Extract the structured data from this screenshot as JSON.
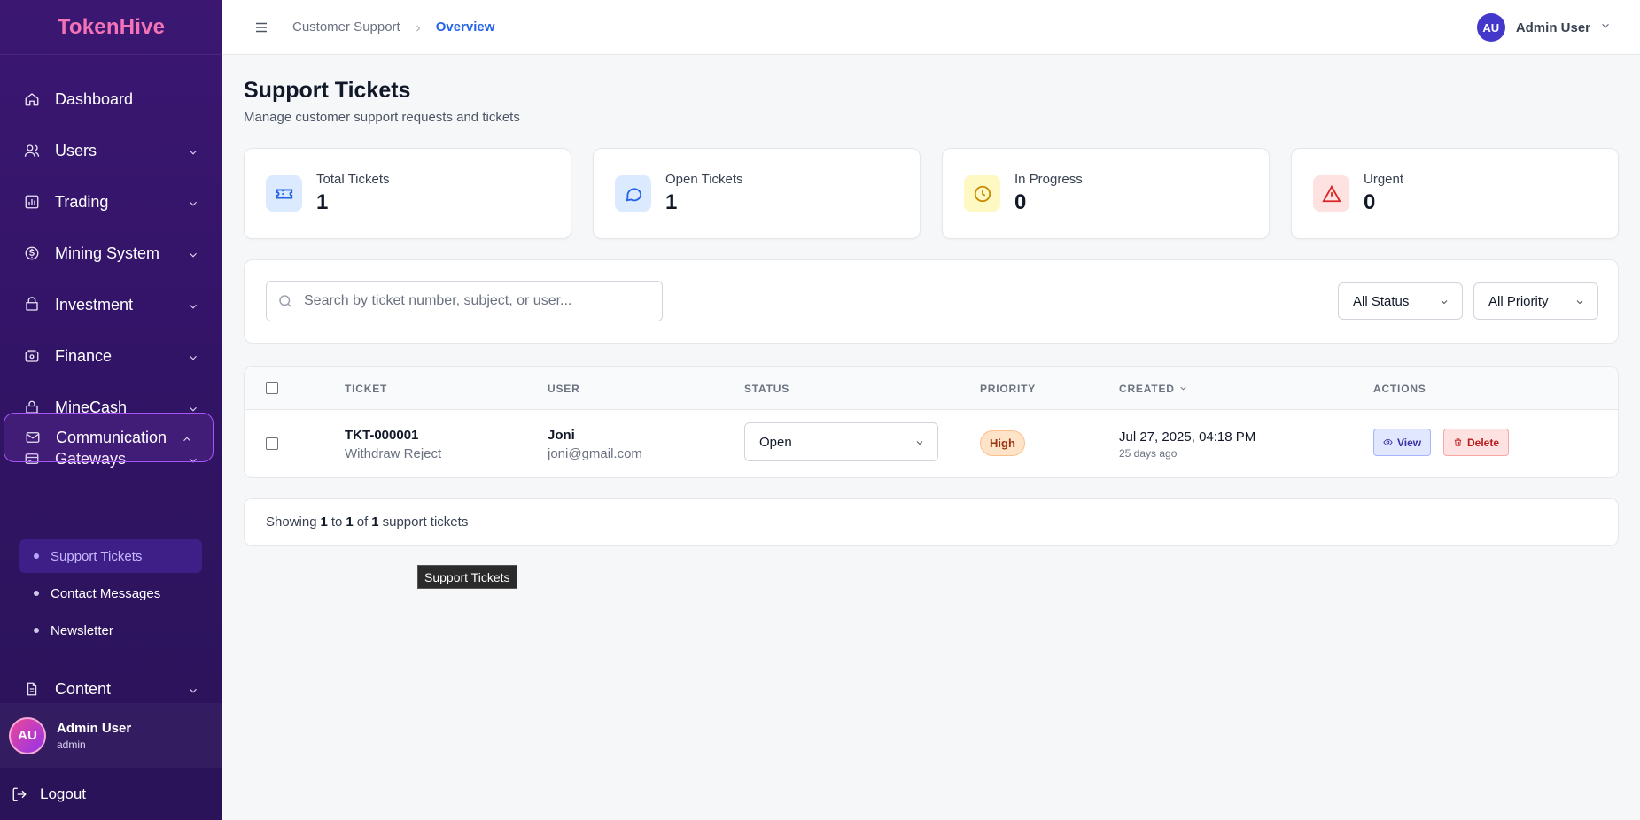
{
  "app": {
    "brand": "TokenHive"
  },
  "sidebar": {
    "items": [
      {
        "label": "Dashboard",
        "icon": "home-icon"
      },
      {
        "label": "Users",
        "icon": "users-icon"
      },
      {
        "label": "Trading",
        "icon": "chart-icon"
      },
      {
        "label": "Mining System",
        "icon": "dollar-circle-icon"
      },
      {
        "label": "Investment",
        "icon": "briefcase-icon"
      },
      {
        "label": "Finance",
        "icon": "wallet-icon"
      },
      {
        "label": "MineCash",
        "icon": "bag-icon"
      },
      {
        "label": "Gateways",
        "icon": "card-icon"
      },
      {
        "label": "Communication",
        "icon": "mail-icon"
      },
      {
        "label": "Content",
        "icon": "document-icon"
      }
    ],
    "submenu": [
      {
        "label": "Support Tickets"
      },
      {
        "label": "Contact Messages"
      },
      {
        "label": "Newsletter"
      }
    ],
    "user": {
      "initials": "AU",
      "name": "Admin User",
      "role": "admin"
    },
    "logout": "Logout"
  },
  "header": {
    "breadcrumb": {
      "parent": "Customer Support",
      "current": "Overview"
    },
    "user": {
      "initials": "AU",
      "name": "Admin User"
    }
  },
  "page": {
    "title": "Support Tickets",
    "subtitle": "Manage customer support requests and tickets"
  },
  "stats": [
    {
      "label": "Total Tickets",
      "value": "1",
      "color": "#2563eb"
    },
    {
      "label": "Open Tickets",
      "value": "1",
      "color": "#2563eb"
    },
    {
      "label": "In Progress",
      "value": "0",
      "color": "#ca8a04"
    },
    {
      "label": "Urgent",
      "value": "0",
      "color": "#dc2626"
    }
  ],
  "filters": {
    "search_placeholder": "Search by ticket number, subject, or user...",
    "status": "All Status",
    "priority": "All Priority"
  },
  "table": {
    "columns": [
      "TICKET",
      "USER",
      "STATUS",
      "PRIORITY",
      "CREATED",
      "ACTIONS"
    ],
    "rows": [
      {
        "ticket": "TKT-000001",
        "subject": "Withdraw Reject",
        "user_name": "Joni",
        "user_email": "joni@gmail.com",
        "status": "Open",
        "priority": "High",
        "created": "Jul 27, 2025, 04:18 PM",
        "created_ago": "25 days ago",
        "view_label": "View",
        "delete_label": "Delete"
      }
    ]
  },
  "pagination": {
    "prefix": "Showing",
    "from": "1",
    "to_word": "to",
    "to": "1",
    "of_word": "of",
    "total": "1",
    "suffix": "support tickets"
  },
  "tooltip": "Support Tickets"
}
